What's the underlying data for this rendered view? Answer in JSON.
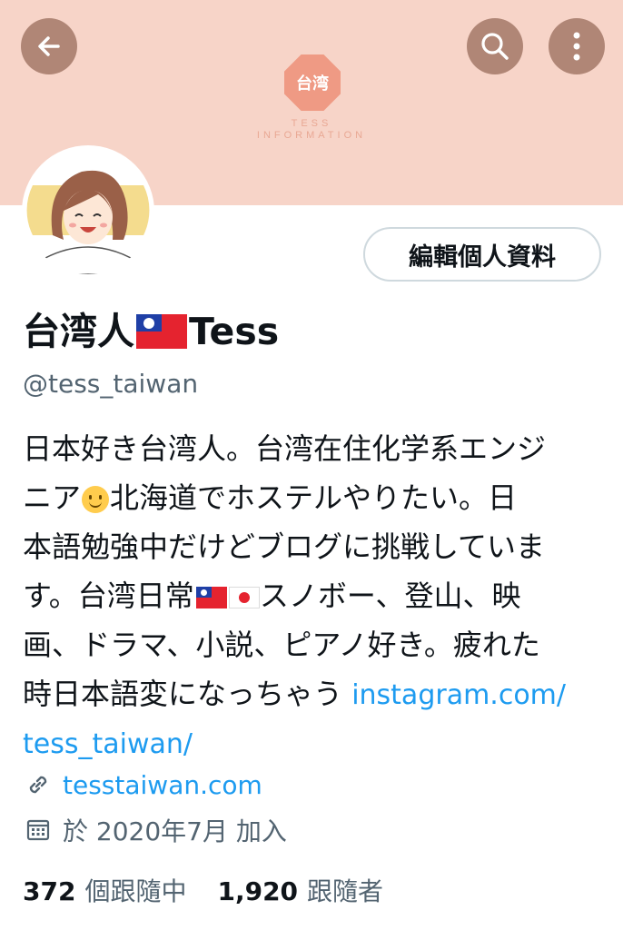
{
  "header": {
    "back_icon": "arrow-left-icon",
    "search_icon": "search-icon",
    "more_icon": "more-vertical-icon",
    "bg_color": "#f7d4c8",
    "button_color": "#b08676"
  },
  "banner": {
    "logo_text": "台湾",
    "logo_sub_line1": "TESS",
    "logo_sub_line2": "INFORMATION"
  },
  "profile": {
    "name_prefix": "台湾人",
    "name_suffix": "Tess",
    "handle": "@tess_taiwan",
    "edit_button_label": "編輯個人資料",
    "bio": {
      "line1": "日本好き台湾人。台湾在住化学系エンジ",
      "line2a": "ニア",
      "line2b": "北海道でホステルやりたい。日",
      "line3": "本語勉強中だけどブログに挑戦していま",
      "line4a": "す。台湾日常",
      "line4b": "スノボー、登山、映",
      "line5": "画、ドラマ、小説、ピアノ好き。疲れた",
      "line6": "時日本語変になっちゃう ",
      "link_part1": "instagram.com/",
      "link_part2": "tess_taiwan/"
    },
    "website": "tesstaiwan.com",
    "joined": "於 2020年7月 加入",
    "following_count": "372",
    "following_label": "個跟隨中",
    "followers_count": "1,920",
    "followers_label": "跟隨者"
  },
  "colors": {
    "accent": "#1d9bf0",
    "secondary_text": "#536471"
  }
}
